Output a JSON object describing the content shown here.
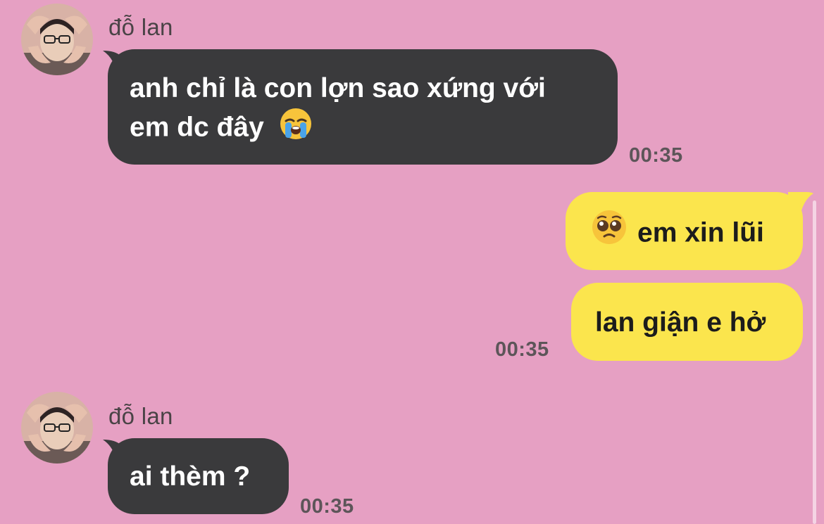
{
  "conversation": {
    "messages": [
      {
        "id": "m1",
        "direction": "incoming",
        "sender": "đỗ lan",
        "lines": [
          "anh chỉ là con lợn sao xứng với",
          "em dc đây"
        ],
        "trailing_emoji": "loudly-crying-face",
        "time": "00:35"
      },
      {
        "id": "m2",
        "direction": "outgoing",
        "leading_emoji": "pleading-face",
        "text": "em xin lũi"
      },
      {
        "id": "m3",
        "direction": "outgoing",
        "text": "lan giận e hở",
        "time": "00:35"
      },
      {
        "id": "m4",
        "direction": "incoming",
        "sender": "đỗ lan",
        "text": "ai thèm ?",
        "time": "00:35"
      }
    ]
  },
  "colors": {
    "background": "#e6a0c3",
    "incoming_bubble": "#3a3a3c",
    "outgoing_bubble": "#fbe54d"
  }
}
